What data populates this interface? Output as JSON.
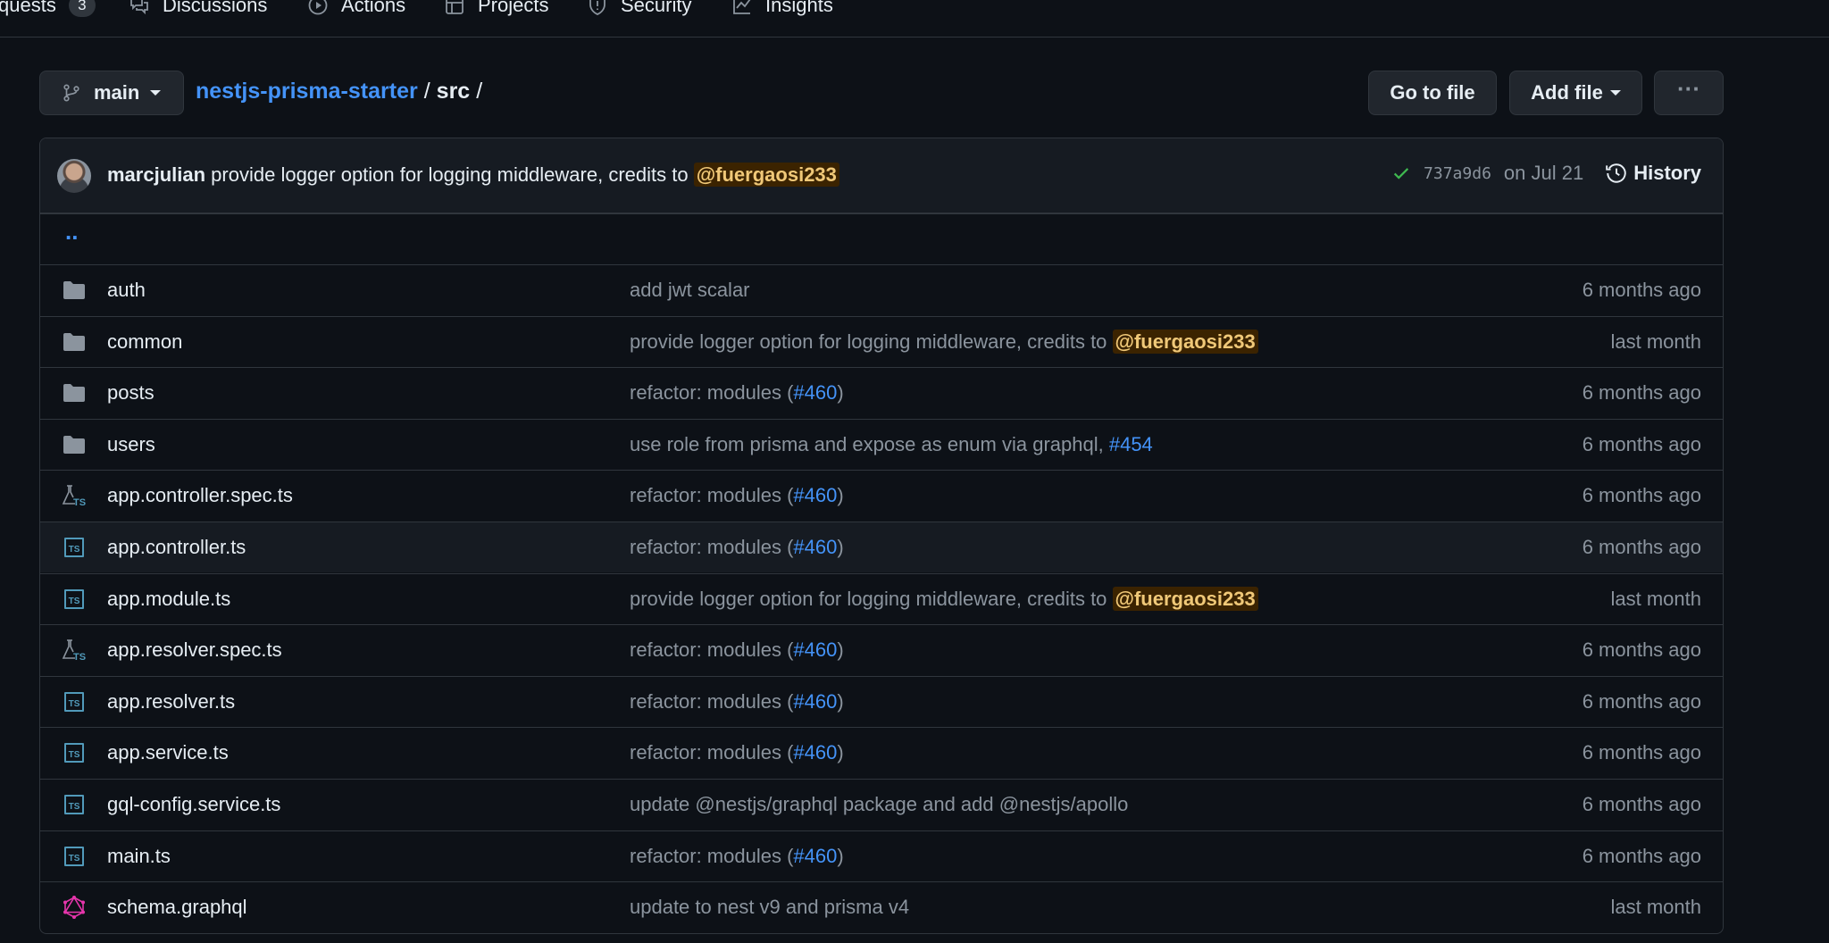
{
  "nav": {
    "pull_requests": "quests",
    "pull_requests_count": "3",
    "discussions": "Discussions",
    "actions": "Actions",
    "projects": "Projects",
    "security": "Security",
    "insights": "Insights"
  },
  "toolbar": {
    "branch": "main",
    "repo": "nestjs-prisma-starter",
    "sep1": "/",
    "folder": "src",
    "sep2": "/",
    "go_to_file": "Go to file",
    "add_file": "Add file",
    "more": "···"
  },
  "commit": {
    "author": "marcjulian",
    "message": "provide logger option for logging middleware, credits to",
    "mention": "@fuergaosi233",
    "sha": "737a9d6",
    "date": "on Jul 21",
    "history": "History"
  },
  "updir": "..",
  "rows": [
    {
      "icon": "folder-icon",
      "name": "auth",
      "msg": "add jwt scalar",
      "pr": "",
      "suffix": "",
      "mention": "",
      "age": "6 months ago"
    },
    {
      "icon": "folder-icon",
      "name": "common",
      "msg": "provide logger option for logging middleware, credits to ",
      "pr": "",
      "suffix": "",
      "mention": "@fuergaosi233",
      "age": "last month"
    },
    {
      "icon": "folder-icon",
      "name": "posts",
      "msg": "refactor: modules (",
      "pr": "#460",
      "suffix": ")",
      "mention": "",
      "age": "6 months ago"
    },
    {
      "icon": "folder-icon",
      "name": "users",
      "msg": "use role from prisma and expose as enum via graphql, ",
      "pr": "#454",
      "suffix": "",
      "mention": "",
      "age": "6 months ago"
    },
    {
      "icon": "test-file-icon",
      "name": "app.controller.spec.ts",
      "msg": "refactor: modules (",
      "pr": "#460",
      "suffix": ")",
      "mention": "",
      "age": "6 months ago"
    },
    {
      "icon": "typescript-file-icon",
      "name": "app.controller.ts",
      "msg": "refactor: modules (",
      "pr": "#460",
      "suffix": ")",
      "mention": "",
      "age": "6 months ago"
    },
    {
      "icon": "typescript-file-icon",
      "name": "app.module.ts",
      "msg": "provide logger option for logging middleware, credits to ",
      "pr": "",
      "suffix": "",
      "mention": "@fuergaosi233",
      "age": "last month"
    },
    {
      "icon": "test-file-icon",
      "name": "app.resolver.spec.ts",
      "msg": "refactor: modules (",
      "pr": "#460",
      "suffix": ")",
      "mention": "",
      "age": "6 months ago"
    },
    {
      "icon": "typescript-file-icon",
      "name": "app.resolver.ts",
      "msg": "refactor: modules (",
      "pr": "#460",
      "suffix": ")",
      "mention": "",
      "age": "6 months ago"
    },
    {
      "icon": "typescript-file-icon",
      "name": "app.service.ts",
      "msg": "refactor: modules (",
      "pr": "#460",
      "suffix": ")",
      "mention": "",
      "age": "6 months ago"
    },
    {
      "icon": "typescript-file-icon",
      "name": "gql-config.service.ts",
      "msg": "update @nestjs/graphql package and add @nestjs/apollo",
      "pr": "",
      "suffix": "",
      "mention": "",
      "age": "6 months ago"
    },
    {
      "icon": "typescript-file-icon",
      "name": "main.ts",
      "msg": "refactor: modules (",
      "pr": "#460",
      "suffix": ")",
      "mention": "",
      "age": "6 months ago"
    },
    {
      "icon": "graphql-file-icon",
      "name": "schema.graphql",
      "msg": "update to nest v9 and prisma v4",
      "pr": "",
      "suffix": "",
      "mention": "",
      "age": "last month"
    }
  ],
  "colors": {
    "background": "#0d1117",
    "border": "#30363d",
    "link": "#4493f8",
    "muted": "#8b949e",
    "success": "#3fb950",
    "graphql": "#e535ab"
  }
}
